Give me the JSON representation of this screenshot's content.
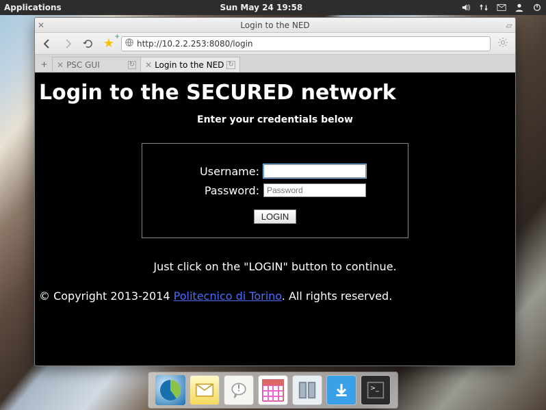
{
  "panel": {
    "applications": "Applications",
    "clock": "Sun May 24 19:58"
  },
  "browser": {
    "title": "Login to the NED",
    "url": "http://10.2.2.253:8080/login",
    "tabs": [
      {
        "label": "PSC GUI",
        "active": false
      },
      {
        "label": "Login to the NED",
        "active": true
      }
    ]
  },
  "page": {
    "heading": "Login to the SECURED network",
    "subheading": "Enter your credentials below",
    "username_label": "Username:",
    "password_label": "Password:",
    "password_placeholder": "Password",
    "login_button": "LOGIN",
    "hint": "Just click on the \"LOGIN\" button to continue.",
    "copyright_pre": "© Copyright 2013-2014 ",
    "copyright_link": "Politecnico di Torino",
    "copyright_post": ". All rights reserved."
  }
}
